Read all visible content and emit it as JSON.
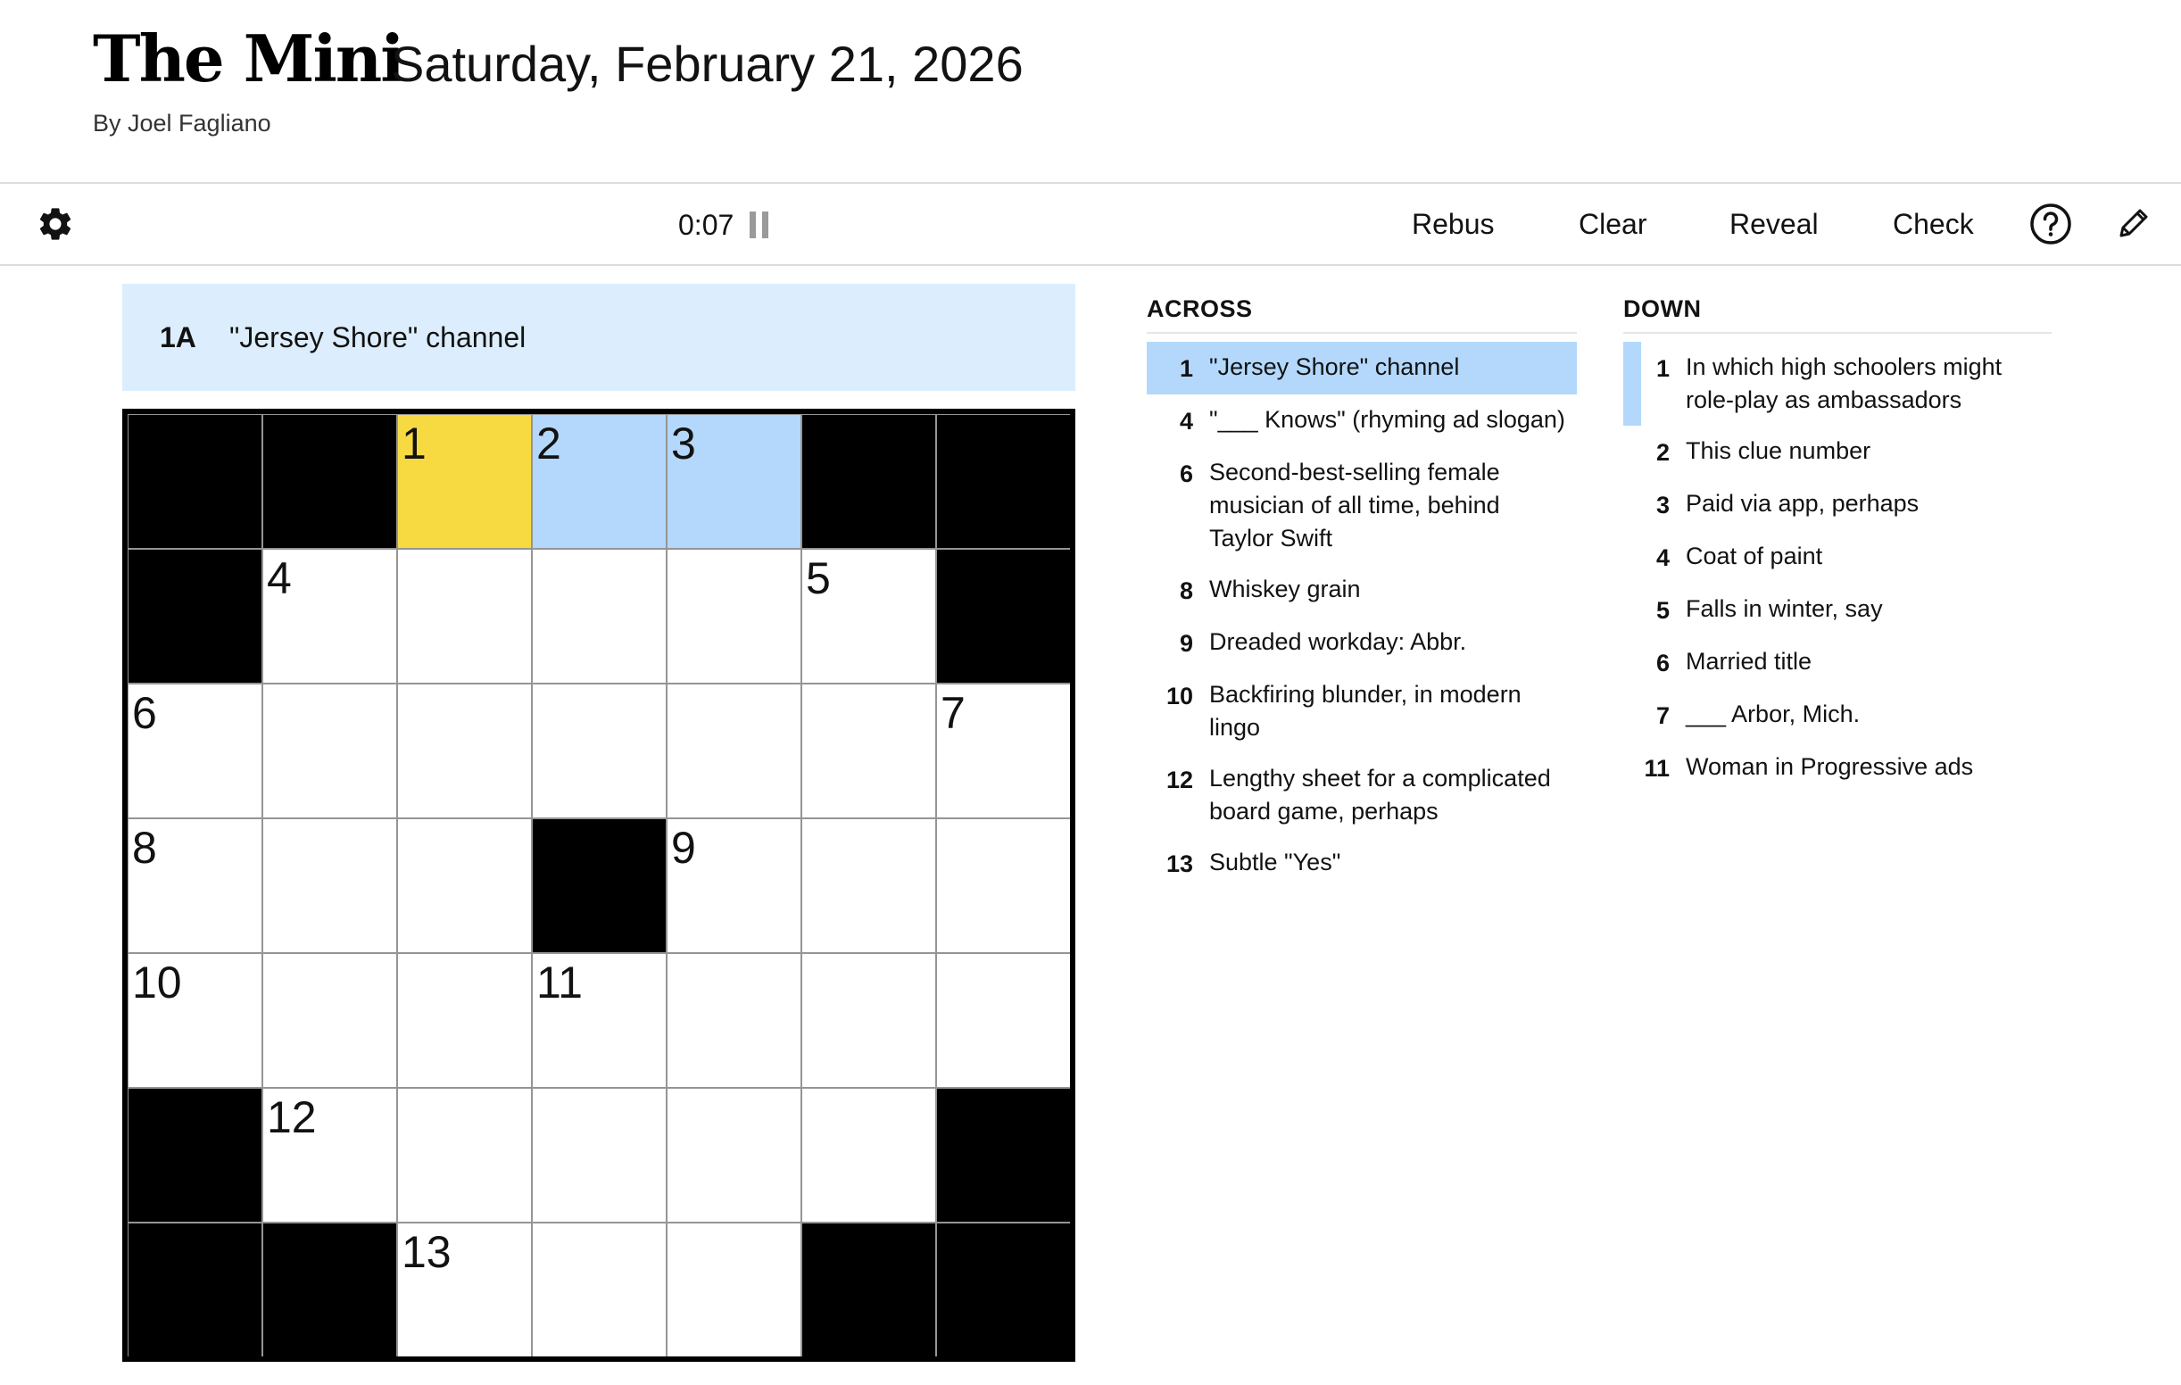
{
  "header": {
    "title": "The Mini",
    "date": "Saturday, February 21, 2026",
    "byline": "By Joel Fagliano"
  },
  "toolbar": {
    "timer": "0:07",
    "rebus": "Rebus",
    "clear": "Clear",
    "reveal": "Reveal",
    "check": "Check",
    "icons": [
      "gear-icon",
      "pause-icon",
      "help-icon",
      "pencil-icon"
    ]
  },
  "current_clue": {
    "label": "1A",
    "text": "\"Jersey Shore\" channel"
  },
  "colors": {
    "selected_cell": "#f7da41",
    "highlight": "#b3d8fb",
    "clue_bar": "#dceefd",
    "block": "#000000"
  },
  "grid": {
    "size": 7,
    "layout": [
      "##...##",
      "#.....#",
      ".......",
      "...#...",
      ".......",
      "#.....#",
      "##...##"
    ],
    "numbers": {
      "0,2": "1",
      "0,3": "2",
      "0,4": "3",
      "1,1": "4",
      "1,5": "5",
      "2,0": "6",
      "2,6": "7",
      "3,0": "8",
      "3,4": "9",
      "4,0": "10",
      "4,3": "11",
      "5,1": "12",
      "6,2": "13"
    },
    "selected": "0,2",
    "highlighted": [
      "0,3",
      "0,4"
    ]
  },
  "clues": {
    "across_title": "ACROSS",
    "down_title": "DOWN",
    "across": [
      {
        "num": "1",
        "text": "\"Jersey Shore\" channel"
      },
      {
        "num": "4",
        "text": "\"___ Knows\" (rhyming ad slogan)"
      },
      {
        "num": "6",
        "text": "Second-best-selling female musician of all time, behind Taylor Swift"
      },
      {
        "num": "8",
        "text": "Whiskey grain"
      },
      {
        "num": "9",
        "text": "Dreaded workday: Abbr."
      },
      {
        "num": "10",
        "text": "Backfiring blunder, in modern lingo"
      },
      {
        "num": "12",
        "text": "Lengthy sheet for a complicated board game, perhaps"
      },
      {
        "num": "13",
        "text": "Subtle \"Yes\""
      }
    ],
    "down": [
      {
        "num": "1",
        "text": "In which high schoolers might role-play as ambassadors"
      },
      {
        "num": "2",
        "text": "This clue number"
      },
      {
        "num": "3",
        "text": "Paid via app, perhaps"
      },
      {
        "num": "4",
        "text": "Coat of paint"
      },
      {
        "num": "5",
        "text": "Falls in winter, say"
      },
      {
        "num": "6",
        "text": "Married title"
      },
      {
        "num": "7",
        "text": "___ Arbor, Mich."
      },
      {
        "num": "11",
        "text": "Woman in Progressive ads"
      }
    ]
  }
}
